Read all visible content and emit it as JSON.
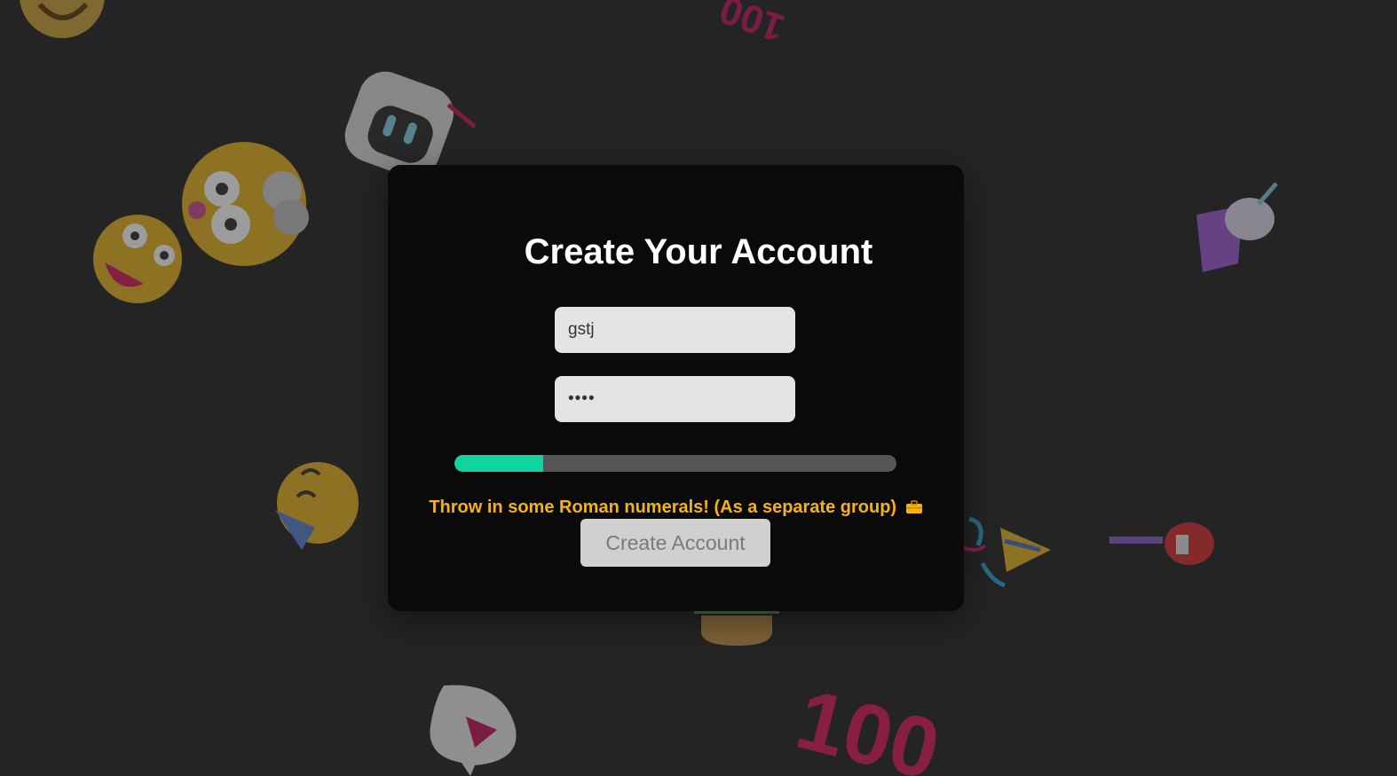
{
  "page": {
    "title": "Create Your Account"
  },
  "form": {
    "username_value": "gstj",
    "password_value": "gstj",
    "strength_fraction": 0.2,
    "hint": "Throw in some Roman numerals! (As a separate group)",
    "hint_icon": "briefcase-emoji",
    "submit_label": "Create Account"
  },
  "colors": {
    "accent": "#10d3a0",
    "hint": "#f5b312",
    "background": "#242424",
    "card": "#0a0a0a"
  },
  "decorations": [
    "grinning-emoji-icon",
    "robot-emoji-icon",
    "startled-emoji-icon",
    "zany-emoji-icon",
    "unicorn-emoji-icon",
    "party-face-emoji-icon",
    "party-popper-emoji-icon",
    "guitar-emoji-icon",
    "burger-emoji-icon",
    "ghost-emoji-icon",
    "hundred-points-emoji-icon"
  ]
}
